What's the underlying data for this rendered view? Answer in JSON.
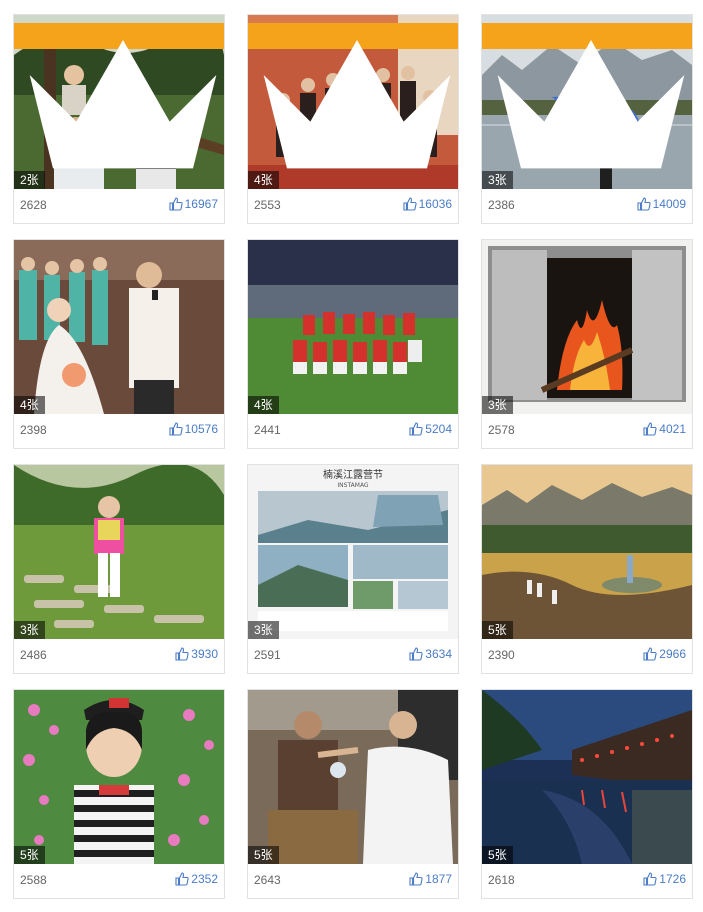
{
  "gallery": {
    "items": [
      {
        "rank": "1",
        "count": "2张",
        "id": "2628",
        "likes": "16967"
      },
      {
        "rank": "2",
        "count": "4张",
        "id": "2553",
        "likes": "16036"
      },
      {
        "rank": "3",
        "count": "3张",
        "id": "2386",
        "likes": "14009"
      },
      {
        "rank": "",
        "count": "4张",
        "id": "2398",
        "likes": "10576"
      },
      {
        "rank": "",
        "count": "4张",
        "id": "2441",
        "likes": "5204"
      },
      {
        "rank": "",
        "count": "3张",
        "id": "2578",
        "likes": "4021"
      },
      {
        "rank": "",
        "count": "3张",
        "id": "2486",
        "likes": "3930"
      },
      {
        "rank": "",
        "count": "3张",
        "id": "2591",
        "likes": "3634"
      },
      {
        "rank": "",
        "count": "5张",
        "id": "2390",
        "likes": "2966"
      },
      {
        "rank": "",
        "count": "5张",
        "id": "2588",
        "likes": "2352"
      },
      {
        "rank": "",
        "count": "5张",
        "id": "2643",
        "likes": "1877"
      },
      {
        "rank": "",
        "count": "5张",
        "id": "2618",
        "likes": "1726"
      }
    ],
    "photo_texts": {
      "poster_title": "楠溪江露营节",
      "poster_sub": "INSTAMAG"
    }
  },
  "colors": {
    "rank_badge": "#f5a31a",
    "like_text": "#4a7cc7",
    "id_text": "#666666"
  },
  "icons": {
    "rank": "crown-icon",
    "like": "thumbs-up-icon"
  }
}
